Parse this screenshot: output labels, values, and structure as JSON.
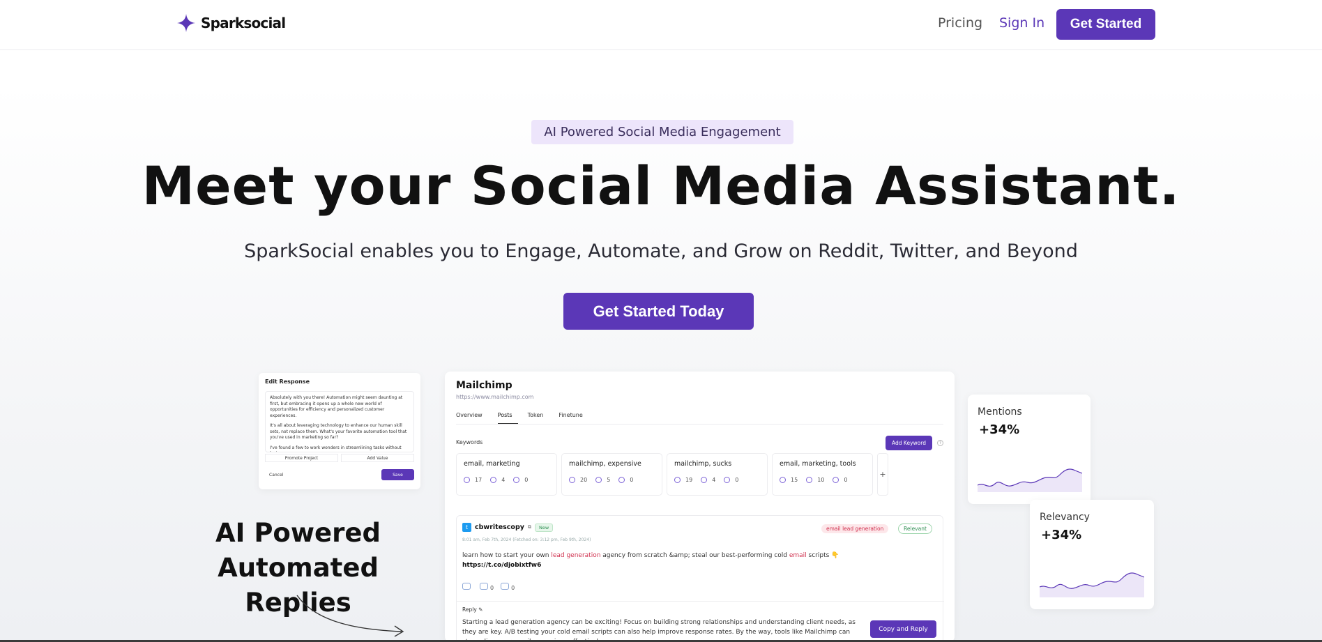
{
  "nav": {
    "logo_text": "Sparksocial",
    "pricing": "Pricing",
    "sign_in": "Sign In",
    "get_started": "Get Started"
  },
  "hero": {
    "badge": "AI Powered Social Media Engagement",
    "title": "Meet your Social Media Assistant.",
    "subtitle": "SparkSocial enables you to Engage, Automate, and Grow on Reddit, Twitter, and Beyond",
    "cta": "Get Started Today"
  },
  "edit_card": {
    "title": "Edit Response",
    "paragraph1": "Absolutely with you there! Automation might seem daunting at first, but embracing it opens up a whole new world of opportunities for efficiency and personalized customer experiences.",
    "paragraph2": "It's all about leveraging technology to enhance our human skill sets, not replace them. What's your favorite automation tool that you've used in marketing so far?",
    "paragraph3": "I've found a few to work wonders in streamlining tasks without losing",
    "action1": "Promote Project",
    "action2": "Add Value",
    "cancel": "Cancel",
    "save": "Save"
  },
  "feature": {
    "line1": "AI Powered",
    "line2": "Automated Replies"
  },
  "app": {
    "title": "Mailchimp",
    "url": "https://www.mailchimp.com",
    "tabs": [
      {
        "label": "Overview",
        "active": false
      },
      {
        "label": "Posts",
        "active": true
      },
      {
        "label": "Token",
        "active": false
      },
      {
        "label": "Finetune",
        "active": false
      }
    ],
    "keywords_label": "Keywords",
    "add_keyword": "Add Keyword",
    "help": "?",
    "keywords": [
      {
        "name": "email, marketing",
        "views": "17",
        "comments": "4",
        "other": "0"
      },
      {
        "name": "mailchimp, expensive",
        "views": "20",
        "comments": "5",
        "other": "0"
      },
      {
        "name": "mailchimp, sucks",
        "views": "19",
        "comments": "4",
        "other": "0"
      },
      {
        "name": "email, marketing, tools",
        "views": "15",
        "comments": "10",
        "other": "0"
      }
    ],
    "add_plus": "+",
    "post": {
      "user": "cbwritescopy",
      "badge_new": "New",
      "meta": "8:01 am, Feb 7th, 2024 (Fetched on: 3:12 pm, Feb 9th, 2024)",
      "tag_lead": "email lead generation",
      "tag_relevant": "Relevant",
      "text_pre": "learn how to start your own ",
      "text_hl1": "lead generation",
      "text_mid": " agency from scratch &amp; steal our best-performing cold ",
      "text_hl2": "email",
      "text_post": " scripts 👇",
      "link": "https://t.co/djobixtfw6",
      "retweets": "0",
      "replies": "0",
      "reply_label": "Reply ✎",
      "reply_text": "Starting a lead generation agency can be exciting! Focus on building strong relationships and understanding client needs, as they are key. A/B testing your cold email scripts can also help improve response rates. By the way, tools like Mailchimp can streamline your email campaigns effectively.",
      "copy_reply": "Copy and Reply"
    }
  },
  "stats": {
    "mentions": {
      "label": "Mentions",
      "value": "+34%"
    },
    "relevancy": {
      "label": "Relevancy",
      "value": "+34%"
    }
  },
  "colors": {
    "accent": "#5b37b7",
    "badge_bg": "#ede5fb"
  }
}
